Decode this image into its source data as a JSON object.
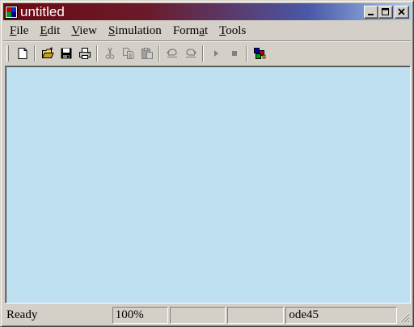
{
  "window": {
    "title": "untitled",
    "icon": "simulink-model-icon",
    "controls": [
      "minimize-icon",
      "maximize-icon",
      "close-icon"
    ]
  },
  "menubar": {
    "items": [
      {
        "label": "File",
        "mnemonic": "F"
      },
      {
        "label": "Edit",
        "mnemonic": "E"
      },
      {
        "label": "View",
        "mnemonic": "V"
      },
      {
        "label": "Simulation",
        "mnemonic": "S"
      },
      {
        "label": "Format",
        "mnemonic": "a"
      },
      {
        "label": "Tools",
        "mnemonic": "T"
      }
    ]
  },
  "toolbar": {
    "buttons": [
      {
        "icon": "new-document-icon",
        "enabled": true
      },
      {
        "icon": "open-folder-icon",
        "enabled": true
      },
      {
        "icon": "save-icon",
        "enabled": true
      },
      {
        "icon": "print-icon",
        "enabled": true
      },
      {
        "icon": "cut-icon",
        "enabled": false
      },
      {
        "icon": "copy-icon",
        "enabled": false
      },
      {
        "icon": "paste-icon",
        "enabled": false
      },
      {
        "icon": "undo-icon",
        "enabled": false
      },
      {
        "icon": "redo-icon",
        "enabled": false
      },
      {
        "icon": "start-simulation-icon",
        "enabled": false
      },
      {
        "icon": "stop-simulation-icon",
        "enabled": false
      },
      {
        "icon": "library-browser-icon",
        "enabled": true
      }
    ]
  },
  "canvas": {
    "background": "#bfe0f0"
  },
  "statusbar": {
    "status": "Ready",
    "zoom": "100%",
    "field3": "",
    "field4": "",
    "solver": "ode45"
  }
}
